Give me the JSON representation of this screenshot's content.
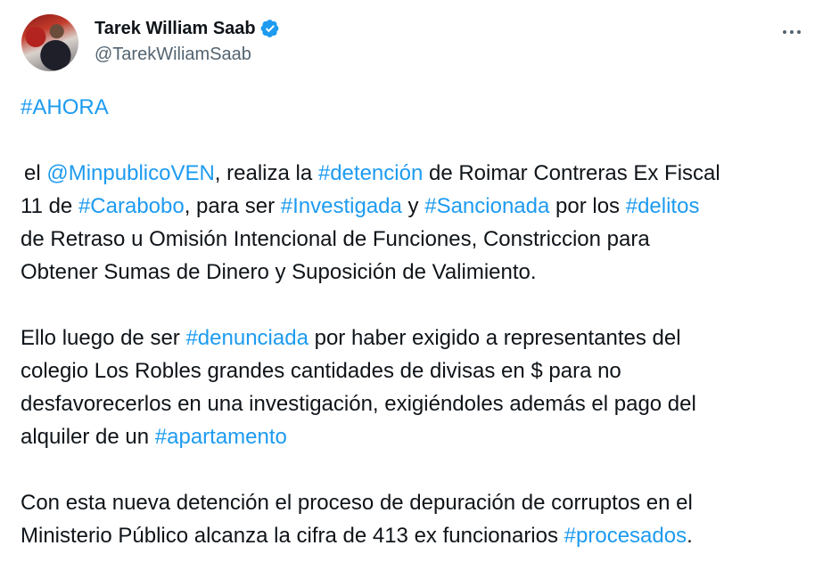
{
  "author": {
    "display_name": "Tarek William Saab",
    "handle": "@TarekWiliamSaab",
    "verified": true,
    "avatar_icon": "profile-photo"
  },
  "menu_icon": "more-horizontal-icon",
  "colors": {
    "link": "#1d9bf0",
    "text": "#0f1419",
    "muted": "#536471",
    "verified": "#1d9bf0"
  },
  "tweet": {
    "p0": {
      "tag": "#AHORA"
    },
    "p1": {
      "t1": "el ",
      "mention": "@MinpublicoVEN",
      "t2": ", realiza la ",
      "tag1": "#detención",
      "t3": " de Roimar Contreras Ex Fiscal",
      "t4": "11 de ",
      "tag2": "#Carabobo",
      "t5": ", para ser ",
      "tag3": "#Investigada",
      "t6": " y ",
      "tag4": "#Sancionada",
      "t7": " por los ",
      "tag5": "#delitos",
      "t8": "de Retraso u Omisión Intencional de Funciones, Constriccion para",
      "t9": "Obtener Sumas de Dinero y Suposición de Valimiento."
    },
    "p2": {
      "t1": "Ello luego de ser ",
      "tag1": "#denunciada",
      "t2": " por haber exigido a representantes del",
      "t3": "colegio Los Robles grandes cantidades de divisas en $ para no",
      "t4": "desfavorecerlos en una investigación, exigiéndoles además el pago del",
      "t5": "alquiler de un ",
      "tag2": "#apartamento"
    },
    "p3": {
      "t1": "Con esta nueva detención el proceso de depuración de corruptos en el",
      "t2": "Ministerio Público alcanza la cifra de 413 ex funcionarios ",
      "tag1": "#procesados",
      "t3": "."
    }
  }
}
